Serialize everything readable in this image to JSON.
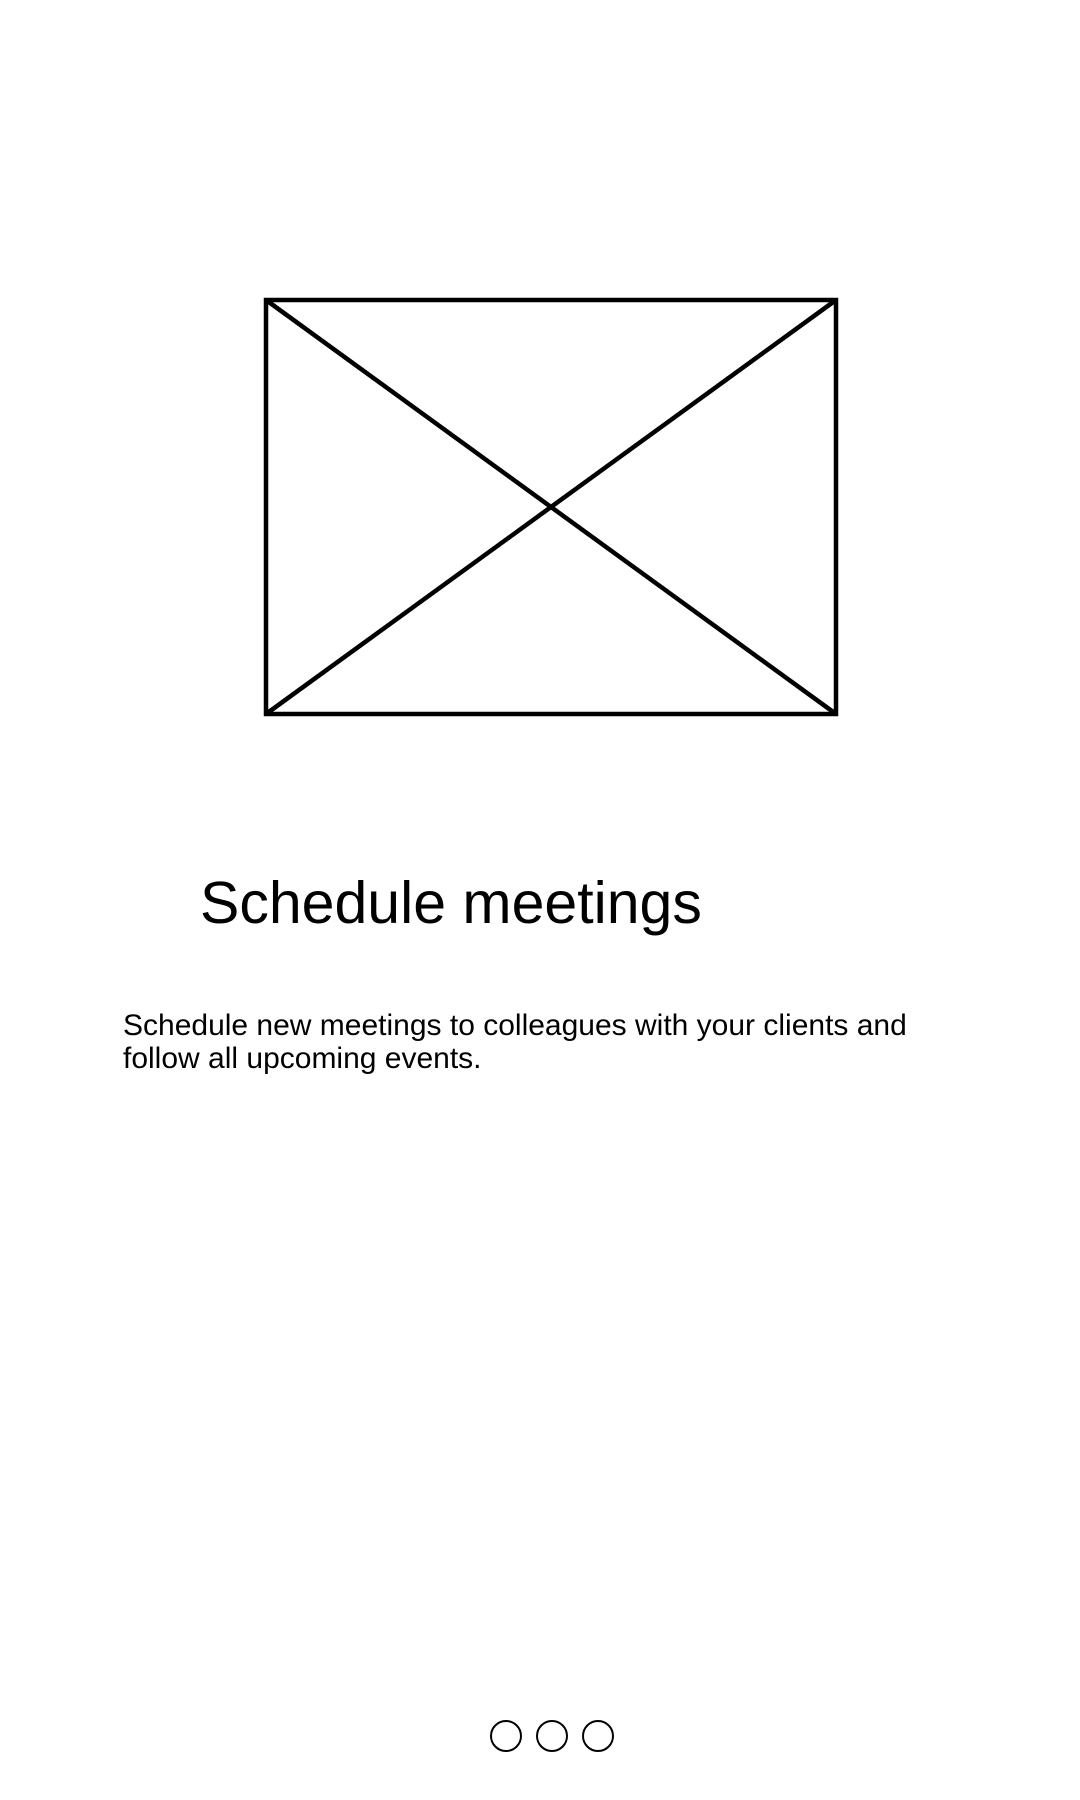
{
  "onboarding": {
    "image_placeholder_icon": "image-placeholder-icon",
    "title": "Schedule meetings",
    "description": "Schedule new meetings to colleagues with your clients and follow all upcoming events."
  },
  "pager": {
    "page_count": 3
  }
}
